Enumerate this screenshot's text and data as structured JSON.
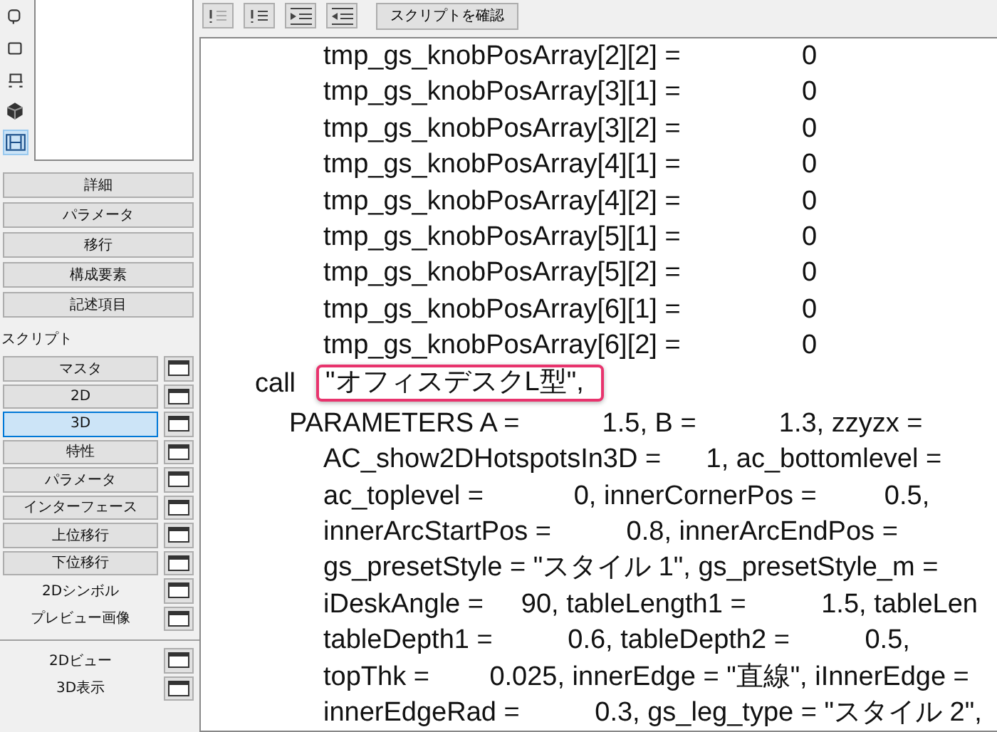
{
  "view_icons": [
    {
      "kind": "shape2",
      "selected": false
    },
    {
      "kind": "square",
      "selected": false
    },
    {
      "kind": "table",
      "selected": false
    },
    {
      "kind": "cube",
      "selected": false
    },
    {
      "kind": "film",
      "selected": true
    }
  ],
  "info_buttons": [
    "詳細",
    "パラメータ",
    "移行",
    "構成要素",
    "記述項目"
  ],
  "script_label": "スクリプト",
  "script_groups": [
    [
      {
        "label": "マスタ",
        "kind": "raised",
        "selected": false
      },
      {
        "label": "2D",
        "kind": "raised",
        "selected": false
      },
      {
        "label": "3D",
        "kind": "raised",
        "selected": true
      },
      {
        "label": "特性",
        "kind": "raised",
        "selected": false
      },
      {
        "label": "パラメータ",
        "kind": "raised",
        "selected": false
      },
      {
        "label": "インターフェース",
        "kind": "raised",
        "selected": false
      },
      {
        "label": "上位移行",
        "kind": "raised",
        "selected": false
      },
      {
        "label": "下位移行",
        "kind": "raised",
        "selected": false
      },
      {
        "label": "2Dシンボル",
        "kind": "flat",
        "selected": false
      },
      {
        "label": "プレビュー画像",
        "kind": "flat",
        "selected": false
      }
    ],
    [
      {
        "label": "2Dビュー",
        "kind": "flat",
        "selected": false
      },
      {
        "label": "3D表示",
        "kind": "flat",
        "selected": false
      }
    ]
  ],
  "toolbar": {
    "tools": [
      {
        "kind": "comment"
      },
      {
        "kind": "uncomment"
      },
      {
        "kind": "indent"
      },
      {
        "kind": "outdent"
      }
    ],
    "check_button": "スクリプトを確認"
  },
  "code_lines": [
    {
      "kind": "assign",
      "text": "tmp_gs_knobPosArray[2][2] =",
      "value": "0"
    },
    {
      "kind": "assign",
      "text": "tmp_gs_knobPosArray[3][1] =",
      "value": "0"
    },
    {
      "kind": "assign",
      "text": "tmp_gs_knobPosArray[3][2] =",
      "value": "0"
    },
    {
      "kind": "assign",
      "text": "tmp_gs_knobPosArray[4][1] =",
      "value": "0"
    },
    {
      "kind": "assign",
      "text": "tmp_gs_knobPosArray[4][2] =",
      "value": "0"
    },
    {
      "kind": "assign",
      "text": "tmp_gs_knobPosArray[5][1] =",
      "value": "0"
    },
    {
      "kind": "assign",
      "text": "tmp_gs_knobPosArray[5][2] =",
      "value": "0"
    },
    {
      "kind": "assign",
      "text": "tmp_gs_knobPosArray[6][1] =",
      "value": "0"
    },
    {
      "kind": "assign",
      "text": "tmp_gs_knobPosArray[6][2] =",
      "value": "0"
    },
    {
      "kind": "call",
      "text": "call",
      "value": "\"オフィスデスクL型\","
    },
    {
      "kind": "params",
      "text": "PARAMETERS A =           1.5, B =           1.3, zzyzx ="
    },
    {
      "kind": "param",
      "text": "AC_show2DHotspotsIn3D =      1, ac_bottomlevel ="
    },
    {
      "kind": "param",
      "text": "ac_toplevel =            0, innerCornerPos =         0.5,"
    },
    {
      "kind": "param",
      "text": "innerArcStartPos =          0.8, innerArcEndPos ="
    },
    {
      "kind": "param",
      "text": "gs_presetStyle = \"スタイル 1\", gs_presetStyle_m ="
    },
    {
      "kind": "param",
      "text": "iDeskAngle =     90, tableLength1 =          1.5, tableLen"
    },
    {
      "kind": "param",
      "text": "tableDepth1 =          0.6, tableDepth2 =          0.5,"
    },
    {
      "kind": "param",
      "text": "topThk =        0.025, innerEdge = \"直線\", iInnerEdge ="
    },
    {
      "kind": "param",
      "text": "innerEdgeRad =          0.3, gs_leg_type = \"スタイル 2\","
    }
  ]
}
